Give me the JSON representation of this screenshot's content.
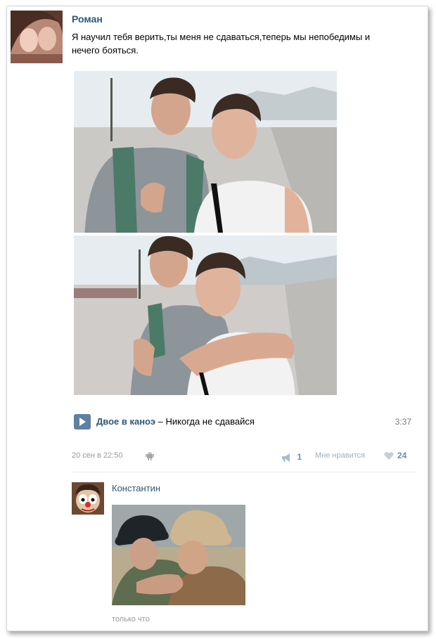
{
  "post": {
    "author": "Роман",
    "text": "Я научил тебя верить,ты меня не сдаваться,теперь мы непобедимы и нечего бояться.",
    "date": "20 сен в 22:50"
  },
  "audio": {
    "artist": "Двое в каноэ",
    "separator": "–",
    "title": "Никогда не сдавайся",
    "duration": "3:37"
  },
  "actions": {
    "repost_count": "1",
    "like_label": "Мне нравится",
    "like_count": "24"
  },
  "comment": {
    "author": "Константин",
    "time": "только что"
  },
  "colors": {
    "link": "#2b587a",
    "muted": "#999999",
    "accent": "#6b8db3"
  },
  "icons": [
    "play-icon",
    "android-icon",
    "repost-icon",
    "heart-icon"
  ]
}
